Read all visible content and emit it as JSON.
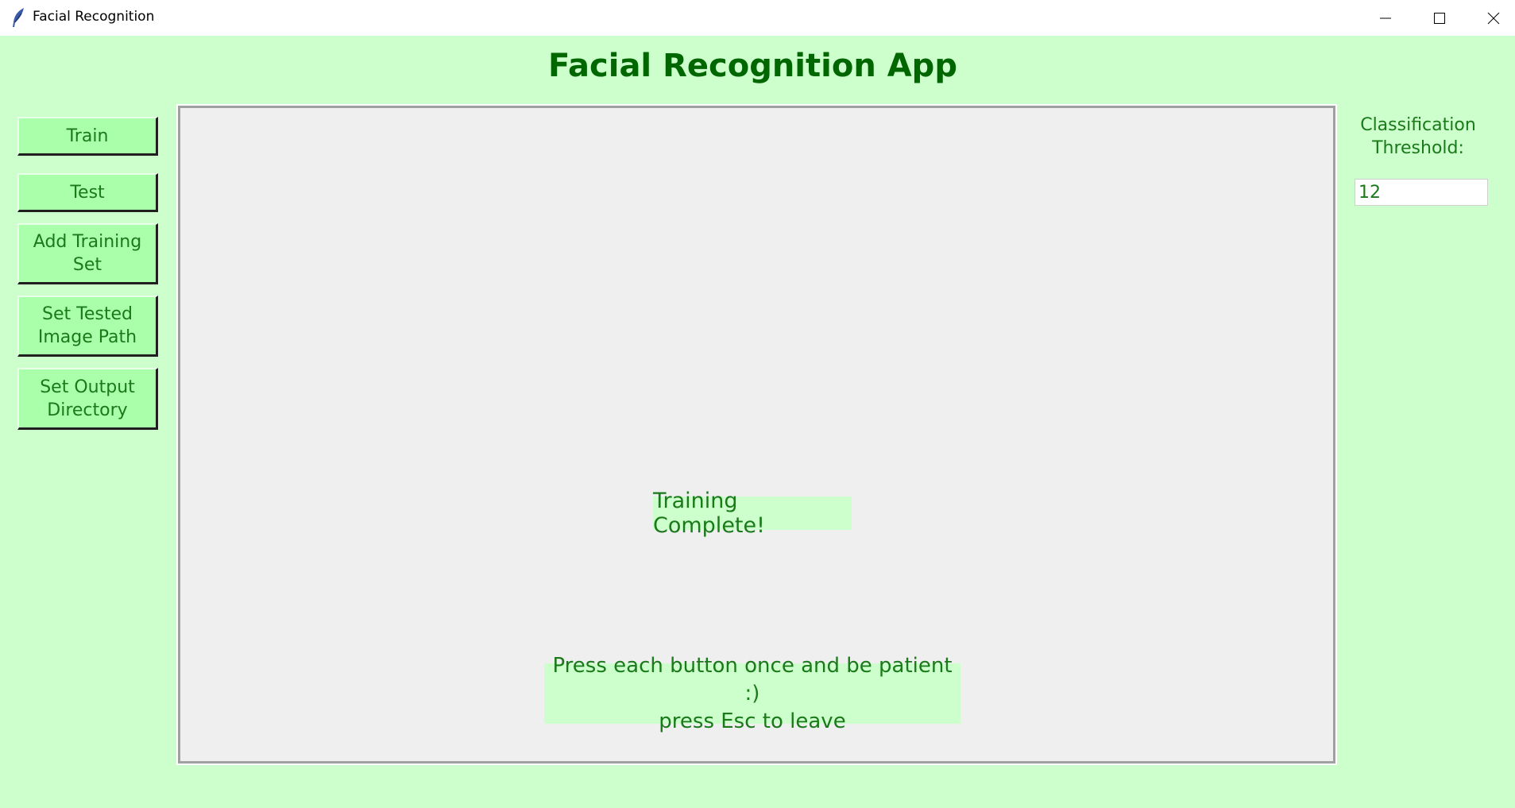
{
  "window": {
    "title": "Facial Recognition",
    "icon": "feather-icon"
  },
  "app": {
    "heading": "Facial Recognition App"
  },
  "sidebar": {
    "buttons": [
      {
        "label": "Train"
      },
      {
        "label": "Test"
      },
      {
        "label": "Add Training\nSet"
      },
      {
        "label": "Set Tested\nImage Path"
      },
      {
        "label": "Set Output\nDirectory"
      }
    ]
  },
  "canvas": {
    "status": "Training Complete!",
    "hint": "Press each button once and be patient :)\npress Esc to leave"
  },
  "threshold": {
    "label": "Classification\nThreshold:",
    "value": "12"
  },
  "colors": {
    "background": "#ccffcc",
    "button": "#aaffaa",
    "text": "#1a7a1a",
    "heading": "#006600",
    "canvas": "#efefef"
  }
}
